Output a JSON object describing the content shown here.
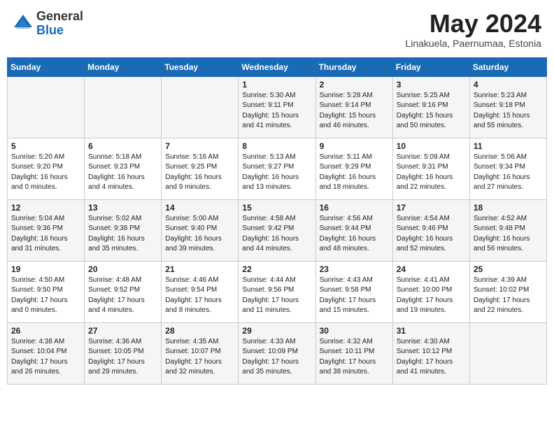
{
  "logo": {
    "general": "General",
    "blue": "Blue"
  },
  "header": {
    "month": "May 2024",
    "location": "Linakuela, Paernumaa, Estonia"
  },
  "days_of_week": [
    "Sunday",
    "Monday",
    "Tuesday",
    "Wednesday",
    "Thursday",
    "Friday",
    "Saturday"
  ],
  "weeks": [
    [
      {
        "day": "",
        "info": ""
      },
      {
        "day": "",
        "info": ""
      },
      {
        "day": "",
        "info": ""
      },
      {
        "day": "1",
        "info": "Sunrise: 5:30 AM\nSunset: 9:11 PM\nDaylight: 15 hours\nand 41 minutes."
      },
      {
        "day": "2",
        "info": "Sunrise: 5:28 AM\nSunset: 9:14 PM\nDaylight: 15 hours\nand 46 minutes."
      },
      {
        "day": "3",
        "info": "Sunrise: 5:25 AM\nSunset: 9:16 PM\nDaylight: 15 hours\nand 50 minutes."
      },
      {
        "day": "4",
        "info": "Sunrise: 5:23 AM\nSunset: 9:18 PM\nDaylight: 15 hours\nand 55 minutes."
      }
    ],
    [
      {
        "day": "5",
        "info": "Sunrise: 5:20 AM\nSunset: 9:20 PM\nDaylight: 16 hours\nand 0 minutes."
      },
      {
        "day": "6",
        "info": "Sunrise: 5:18 AM\nSunset: 9:23 PM\nDaylight: 16 hours\nand 4 minutes."
      },
      {
        "day": "7",
        "info": "Sunrise: 5:16 AM\nSunset: 9:25 PM\nDaylight: 16 hours\nand 9 minutes."
      },
      {
        "day": "8",
        "info": "Sunrise: 5:13 AM\nSunset: 9:27 PM\nDaylight: 16 hours\nand 13 minutes."
      },
      {
        "day": "9",
        "info": "Sunrise: 5:11 AM\nSunset: 9:29 PM\nDaylight: 16 hours\nand 18 minutes."
      },
      {
        "day": "10",
        "info": "Sunrise: 5:09 AM\nSunset: 9:31 PM\nDaylight: 16 hours\nand 22 minutes."
      },
      {
        "day": "11",
        "info": "Sunrise: 5:06 AM\nSunset: 9:34 PM\nDaylight: 16 hours\nand 27 minutes."
      }
    ],
    [
      {
        "day": "12",
        "info": "Sunrise: 5:04 AM\nSunset: 9:36 PM\nDaylight: 16 hours\nand 31 minutes."
      },
      {
        "day": "13",
        "info": "Sunrise: 5:02 AM\nSunset: 9:38 PM\nDaylight: 16 hours\nand 35 minutes."
      },
      {
        "day": "14",
        "info": "Sunrise: 5:00 AM\nSunset: 9:40 PM\nDaylight: 16 hours\nand 39 minutes."
      },
      {
        "day": "15",
        "info": "Sunrise: 4:58 AM\nSunset: 9:42 PM\nDaylight: 16 hours\nand 44 minutes."
      },
      {
        "day": "16",
        "info": "Sunrise: 4:56 AM\nSunset: 9:44 PM\nDaylight: 16 hours\nand 48 minutes."
      },
      {
        "day": "17",
        "info": "Sunrise: 4:54 AM\nSunset: 9:46 PM\nDaylight: 16 hours\nand 52 minutes."
      },
      {
        "day": "18",
        "info": "Sunrise: 4:52 AM\nSunset: 9:48 PM\nDaylight: 16 hours\nand 56 minutes."
      }
    ],
    [
      {
        "day": "19",
        "info": "Sunrise: 4:50 AM\nSunset: 9:50 PM\nDaylight: 17 hours\nand 0 minutes."
      },
      {
        "day": "20",
        "info": "Sunrise: 4:48 AM\nSunset: 9:52 PM\nDaylight: 17 hours\nand 4 minutes."
      },
      {
        "day": "21",
        "info": "Sunrise: 4:46 AM\nSunset: 9:54 PM\nDaylight: 17 hours\nand 8 minutes."
      },
      {
        "day": "22",
        "info": "Sunrise: 4:44 AM\nSunset: 9:56 PM\nDaylight: 17 hours\nand 11 minutes."
      },
      {
        "day": "23",
        "info": "Sunrise: 4:43 AM\nSunset: 9:58 PM\nDaylight: 17 hours\nand 15 minutes."
      },
      {
        "day": "24",
        "info": "Sunrise: 4:41 AM\nSunset: 10:00 PM\nDaylight: 17 hours\nand 19 minutes."
      },
      {
        "day": "25",
        "info": "Sunrise: 4:39 AM\nSunset: 10:02 PM\nDaylight: 17 hours\nand 22 minutes."
      }
    ],
    [
      {
        "day": "26",
        "info": "Sunrise: 4:38 AM\nSunset: 10:04 PM\nDaylight: 17 hours\nand 26 minutes."
      },
      {
        "day": "27",
        "info": "Sunrise: 4:36 AM\nSunset: 10:05 PM\nDaylight: 17 hours\nand 29 minutes."
      },
      {
        "day": "28",
        "info": "Sunrise: 4:35 AM\nSunset: 10:07 PM\nDaylight: 17 hours\nand 32 minutes."
      },
      {
        "day": "29",
        "info": "Sunrise: 4:33 AM\nSunset: 10:09 PM\nDaylight: 17 hours\nand 35 minutes."
      },
      {
        "day": "30",
        "info": "Sunrise: 4:32 AM\nSunset: 10:11 PM\nDaylight: 17 hours\nand 38 minutes."
      },
      {
        "day": "31",
        "info": "Sunrise: 4:30 AM\nSunset: 10:12 PM\nDaylight: 17 hours\nand 41 minutes."
      },
      {
        "day": "",
        "info": ""
      }
    ]
  ]
}
